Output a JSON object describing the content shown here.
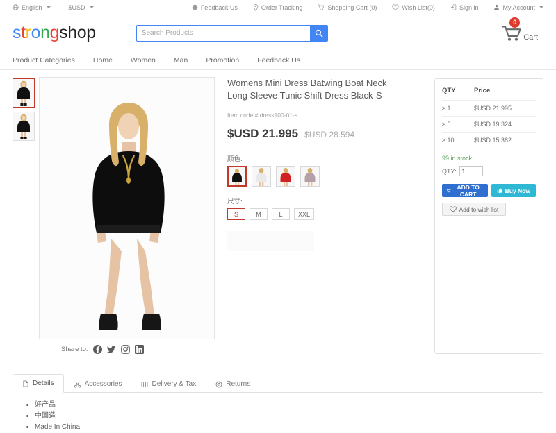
{
  "topbar": {
    "language": "English",
    "currency": "$USD",
    "feedback": "Feedback Us",
    "order_tracking": "Order Tracking",
    "shopping_cart": "Shopping Cart (0)",
    "wish_list": "Wish List(0)",
    "sign_in": "Sign in",
    "my_account": "My Account"
  },
  "header": {
    "logo_letters": [
      {
        "ch": "s",
        "color": "#4285f4"
      },
      {
        "ch": "t",
        "color": "#ea4335"
      },
      {
        "ch": "r",
        "color": "#fbbc05"
      },
      {
        "ch": "o",
        "color": "#4285f4"
      },
      {
        "ch": "n",
        "color": "#34a853"
      },
      {
        "ch": "g",
        "color": "#ea4335"
      },
      {
        "ch": "s",
        "color": "#222222"
      },
      {
        "ch": "h",
        "color": "#222222"
      },
      {
        "ch": "o",
        "color": "#222222"
      },
      {
        "ch": "p",
        "color": "#222222"
      }
    ],
    "logo_text": "strongshop",
    "search_placeholder": "Search Products",
    "search_value": "",
    "cart_count": "0",
    "cart_label": "Cart",
    "accent_color": "#4285f4",
    "cart_badge_color": "#e03b2f"
  },
  "nav": {
    "items": [
      {
        "label": "Product Categories"
      },
      {
        "label": "Home"
      },
      {
        "label": "Women"
      },
      {
        "label": "Man"
      },
      {
        "label": "Promotion"
      },
      {
        "label": "Feedback Us"
      }
    ]
  },
  "gallery": {
    "thumbnails": [
      {
        "alt": "Model wearing black batwing mini dress front view",
        "active": true
      },
      {
        "alt": "Model wearing black batwing mini dress second view",
        "active": false
      }
    ],
    "main_image_alt": "Blonde model in black batwing boat neck mini dress with gold chain necklace and black ankle boots on white background",
    "share_label": "Share to:",
    "share_icons": [
      "facebook-icon",
      "twitter-icon",
      "instagram-icon",
      "linkedin-icon"
    ]
  },
  "product": {
    "title": "Womens Mini Dress Batwing Boat Neck Long Sleeve Tunic Shift Dress Black-S",
    "item_code": "Item code #:dress100-01-s",
    "price_current": "$USD 21.995",
    "price_original": "$USD 28.594",
    "color_label": "颜色:",
    "colors": [
      {
        "name": "black",
        "swatch": "#111111",
        "active": true
      },
      {
        "name": "white",
        "swatch": "#e9e9ea",
        "active": false
      },
      {
        "name": "red",
        "swatch": "#cf2222",
        "active": false
      },
      {
        "name": "mauve",
        "swatch": "#b4a0a6",
        "active": false
      }
    ],
    "size_label": "尺寸:",
    "sizes": [
      {
        "label": "S",
        "active": true
      },
      {
        "label": "M",
        "active": false
      },
      {
        "label": "L",
        "active": false
      },
      {
        "label": "XXL",
        "active": false
      }
    ]
  },
  "buybox": {
    "col_qty": "QTY",
    "col_price": "Price",
    "tiers": [
      {
        "qty": "≥  1",
        "price": "$USD 21.995"
      },
      {
        "qty": "≥  5",
        "price": "$USD 19.324"
      },
      {
        "qty": "≥  10",
        "price": "$USD 15.382"
      }
    ],
    "stock": "99 in stock.",
    "stock_color": "#5aa05a",
    "qty_label": "QTY:",
    "qty_value": "1",
    "add_to_cart": "ADD TO CART",
    "buy_now": "Buy Now",
    "add_to_wish": "Add to wish list",
    "cart_color": "#2f6fd0",
    "buy_color": "#2eb8d4"
  },
  "tabs": {
    "items": [
      {
        "label": "Details",
        "icon": "details-icon",
        "active": true
      },
      {
        "label": "Accessories",
        "icon": "accessories-icon",
        "active": false
      },
      {
        "label": "Delivery & Tax",
        "icon": "delivery-icon",
        "active": false
      },
      {
        "label": "Returns",
        "icon": "returns-icon",
        "active": false
      }
    ],
    "details_list": [
      "好产品",
      "中国造",
      "Made In China"
    ]
  }
}
